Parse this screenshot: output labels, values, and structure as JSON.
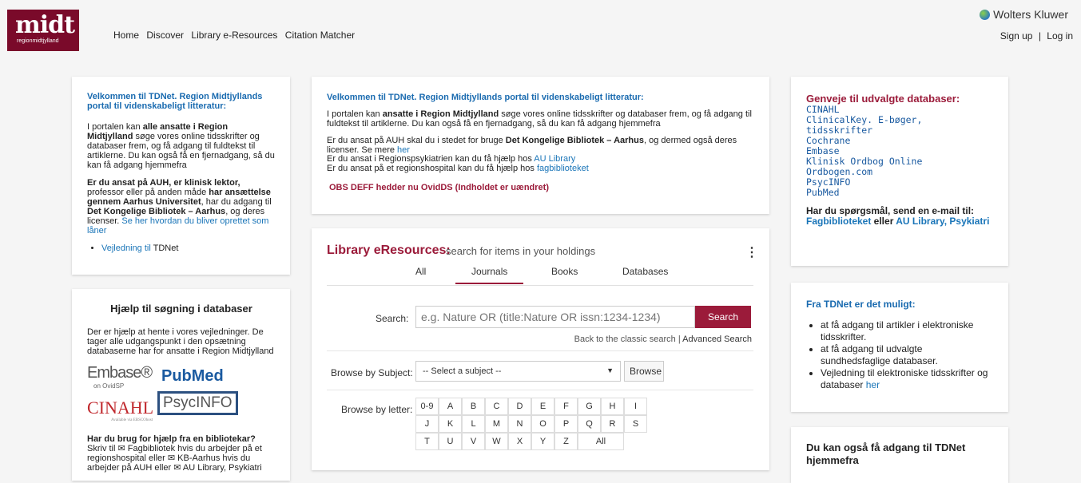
{
  "header": {
    "logo_text": "midt",
    "logo_sub": "regionmidtjylland",
    "nav": [
      "Home",
      "Discover",
      "Library e-Resources",
      "Citation Matcher"
    ],
    "brand": "Wolters Kluwer",
    "sign_up": "Sign up",
    "separator": "|",
    "log_in": "Log in"
  },
  "left1": {
    "title": "Velkommen til TDNet. Region Midtjyllands portal til videnskabeligt litteratur:",
    "p1_pre": "I portalen kan ",
    "p1_bold": "alle ansatte i Region Midtjylland",
    "p1_post": " søge vores online tidsskrifter og databaser frem, og få adgang til fuldtekst til artiklerne. Du kan også få en fjernadgang, så du kan få adgang hjemmefra",
    "p2_bold1": "Er du ansat på AUH, er klinisk lektor,",
    "p2_mid1": " professor eller på anden måde ",
    "p2_bold2": "har ansættelse gennem Aarhus Universitet",
    "p2_mid2": ", har du adgang til ",
    "p2_bold3": "Det Kongelige Bibliotek – Aarhus",
    "p2_mid3": ", og deres licenser. ",
    "p2_link": "Se her hvordan du bliver oprettet som låner",
    "bullet_link": "Vejledning til",
    "bullet_text": " TDNet"
  },
  "left2": {
    "title": "Hjælp til søgning i databaser",
    "intro": "Der er hjælp at hente i vores  vejledninger. De tager alle udgangspunkt i den opsætning databaserne har for ansatte i Region Midtjylland",
    "logo_embase": "Embase®",
    "logo_embase_sub": "on OvidSP",
    "logo_pubmed": "PubMed",
    "logo_cinahl": "CINAHL",
    "logo_cinahl_sub": "Available via EBSCOhost",
    "logo_psycinfo": "PsycINFO",
    "help_title": "Har du brug for hjælp fra en bibliotekar?",
    "help_text": "Skriv til ✉ Fagbibliotek hvis du arbejder på et regionshospital eller ✉ KB-Aarhus hvis du arbejder på AUH eller ✉ AU Library, Psykiatri"
  },
  "center1": {
    "title": "Velkommen til TDNet. Region Midtjyllands portal til videnskabeligt litteratur:",
    "p1_pre": "I portalen kan ",
    "p1_bold": "ansatte i Region Midtjylland",
    "p1_post": " søge vores online tidsskrifter og databaser frem, og få adgang til fuldtekst til artiklerne. Du kan også få en fjernadgang, så du kan få adgang hjemmefra",
    "p2_pre": "Er du ansat på AUH skal du i stedet for bruge ",
    "p2_bold": "Det Kongelige Bibliotek – Aarhus",
    "p2_post": ", og dermed også deres licenser. Se mere ",
    "p2_link": "her",
    "p3_pre": "Er du ansat i Regionspsykiatrien kan du få hjælp hos ",
    "p3_link": "AU Library",
    "p4_pre": "Er du ansat på et regionshospital kan du få hjælp hos ",
    "p4_link": "fagbiblioteket",
    "obs": "OBS DEFF hedder nu OvidDS (Indholdet er uændret)"
  },
  "eres": {
    "title": "Library eResources:",
    "subtitle": "search for items in your holdings",
    "kebab": "⋮",
    "tabs": [
      "All",
      "Journals",
      "Books",
      "Databases"
    ],
    "search_label": "Search:",
    "search_placeholder": "e.g. Nature OR (title:Nature OR issn:1234-1234)",
    "search_button": "Search",
    "classic_link": "Back to the classic search",
    "classic_sep": " | ",
    "advanced_link": "Advanced Search",
    "subject_label": "Browse by Subject:",
    "subject_value": "-- Select a subject --",
    "caret": "▼",
    "browse_button": "Browse",
    "letter_label": "Browse by letter:",
    "letters_row1": [
      "0-9",
      "A",
      "B",
      "C",
      "D",
      "E",
      "F",
      "G",
      "H",
      "I"
    ],
    "letters_row2": [
      "J",
      "K",
      "L",
      "M",
      "N",
      "O",
      "P",
      "Q",
      "R",
      "S"
    ],
    "letters_row3": [
      "T",
      "U",
      "V",
      "W",
      "X",
      "Y",
      "Z"
    ],
    "letters_all": "All"
  },
  "right1": {
    "title": "Genveje til udvalgte databaser:",
    "databases": [
      "CINAHL",
      "ClinicalKey. E-bøger, tidsskrifter",
      "Cochrane",
      "Embase",
      "Klinisk Ordbog Online",
      "Ordbogen.com",
      "PsycINFO",
      "PubMed"
    ],
    "question": "Har du spørgsmål, send en e-mail til:",
    "link1": "Fagbiblioteket",
    "or": " eller ",
    "link2": "AU Library, Psykiatri"
  },
  "right2": {
    "title": "Fra TDNet er det muligt:",
    "items": [
      "at få adgang til artikler i elektroniske tidsskrifter.",
      "at få adgang til udvalgte sundhedsfaglige databaser."
    ],
    "item3_pre": "Vejledning til elektroniske tidsskrifter og databaser ",
    "item3_link": "her"
  },
  "right3": {
    "title": "Du kan også få adgang til TDNet hjemmefra"
  }
}
